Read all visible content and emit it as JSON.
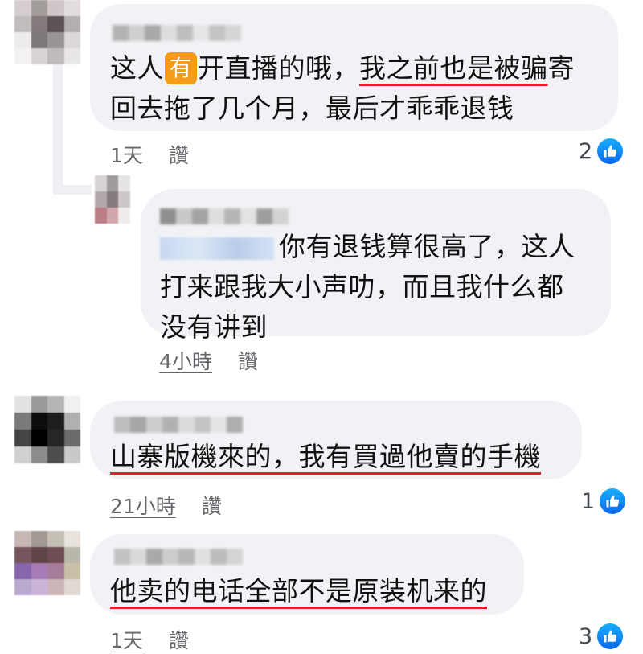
{
  "comments": [
    {
      "avatar_colors": [
        "#d5cdcf",
        "#a29d9a",
        "#cfc6c8",
        "#e3dcde",
        "#c2bdbd",
        "#84797b",
        "#5c5153",
        "#b3aeb1",
        "#eeebec",
        "#7d777a",
        "#9a9496",
        "#dcd7d9",
        "#f3f1f2",
        "#d8d3d5",
        "#c0babc",
        "#e9e6e7"
      ],
      "name_blur_colors": [
        "#b4b4b4",
        "#cfcfcf",
        "#a8a8a8",
        "#dddddd",
        "#bebebe",
        "#e6e6e6",
        "#c4c4c4",
        "#d6d6d6"
      ],
      "text_before": "这人",
      "emoji": "有",
      "text_mid": "开直播的哦，",
      "text_underlined": "我之前也是被骗",
      "text_after_line1": "寄",
      "text_line2": "回去拖了几个月，最后才乖乖退钱",
      "time": "1天",
      "like_label": "讚",
      "reaction_count": "2"
    },
    {
      "avatar_colors": [
        "#d7d3d5",
        "#9f9a9c",
        "#e6e3e4",
        "#b2a8aa",
        "#847b7d",
        "#ccc6c8",
        "#bb7d86",
        "#d2a6ad",
        "#f0ebec"
      ],
      "name_blur_colors": [
        "#8f8f8f",
        "#c9c9c9",
        "#a3a3a3",
        "#dedede",
        "#b5b5b5",
        "#e3e3e3",
        "#9e9e9e",
        "#d3d3d3"
      ],
      "line1": "你有退钱算很高了，这人",
      "line2": "打来跟我大小声叻，而且我什么都",
      "line3": "没有讲到",
      "time": "4小時",
      "like_label": "讚"
    },
    {
      "avatar_colors": [
        "#e2e2e2",
        "#9a9a9a",
        "#b5b5b5",
        "#f0f0f0",
        "#7a7a7a",
        "#0d0d0d",
        "#1e1e1e",
        "#b0b0b0",
        "#444444",
        "#000000",
        "#262626",
        "#6b6b6b",
        "#d0d0d0",
        "#8c8c8c",
        "#4d4d4d",
        "#c9c9c9"
      ],
      "name_blur_colors": [
        "#bdbdbd",
        "#a6a6a6",
        "#cdcdcd",
        "#b1b1b1",
        "#dcdcdc",
        "#c3c3c3",
        "#e4e4e4",
        "#aeaeae"
      ],
      "text_underlined": "山寨版機來的，我有買過他賣的手機",
      "time": "21小時",
      "like_label": "讚",
      "reaction_count": "1"
    },
    {
      "avatar_colors": [
        "#c7b8b5",
        "#a09a93",
        "#c4c0b6",
        "#e8e4dd",
        "#75565d",
        "#5e4447",
        "#6d4c53",
        "#b9b7ab",
        "#8765ac",
        "#a77bb6",
        "#a77b9a",
        "#c7bfa6",
        "#b9a9cf",
        "#cbb3d7",
        "#cdb4b7",
        "#e1dad4"
      ],
      "name_blur_colors": [
        "#c2c2c2",
        "#dadada",
        "#a9a9a9",
        "#cccccc",
        "#b7b7b7",
        "#e0e0e0",
        "#bbbbbb",
        "#d4d4d4"
      ],
      "text_underlined": "他卖的电话全部不是原装机来的",
      "time": "1天",
      "like_label": "讚",
      "reaction_count": "3"
    }
  ],
  "colors": {
    "bubble_bg": "#f0f2f5",
    "underline": "#e41e26",
    "like_blue": "#1877f2",
    "meta_text": "#65676b"
  },
  "icons": {
    "like": "thumbs-up-icon"
  }
}
